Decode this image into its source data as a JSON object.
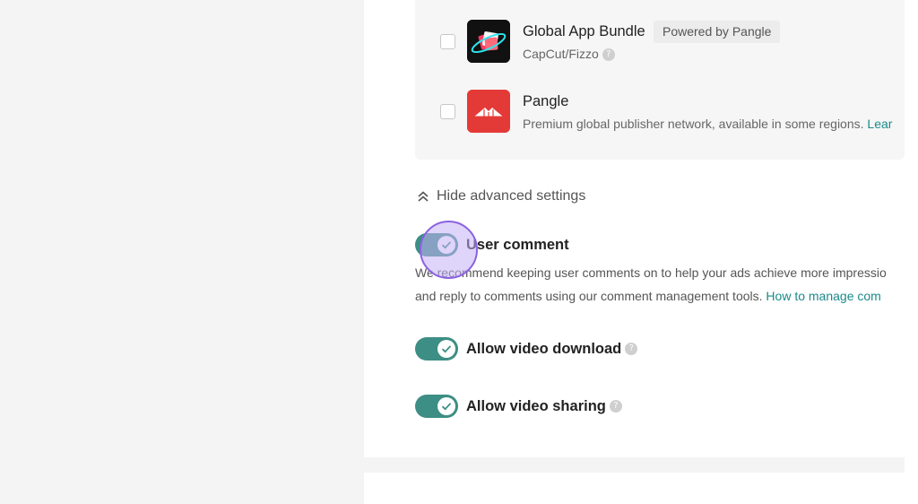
{
  "placements": {
    "items": [
      {
        "title": "Global App Bundle",
        "badge": "Powered by Pangle",
        "subtitle": "CapCut/Fizzo",
        "icon": "global-app-bundle-logo",
        "checked": false
      },
      {
        "title": "Pangle",
        "subtitle": "Premium global publisher network, available in some regions.",
        "subtitle_link": "Lear",
        "icon": "pangle-logo",
        "checked": false
      }
    ]
  },
  "advanced": {
    "toggle_label": "Hide advanced settings",
    "icon": "double-chevron-up-icon"
  },
  "settings": {
    "user_comment": {
      "label": "User comment",
      "enabled": true,
      "desc_line1": "We recommend keeping user comments on to help your ads achieve more impressio",
      "desc_line2": "and reply to comments using our comment management tools.",
      "desc_link": "How to manage com"
    },
    "video_download": {
      "label": "Allow video download",
      "enabled": true
    },
    "video_sharing": {
      "label": "Allow video sharing",
      "enabled": true
    }
  },
  "colors": {
    "accent": "#3d8e84",
    "link": "#1a8a8a",
    "pangle_red": "#e43a37",
    "click_highlight": "#8b62e0"
  }
}
